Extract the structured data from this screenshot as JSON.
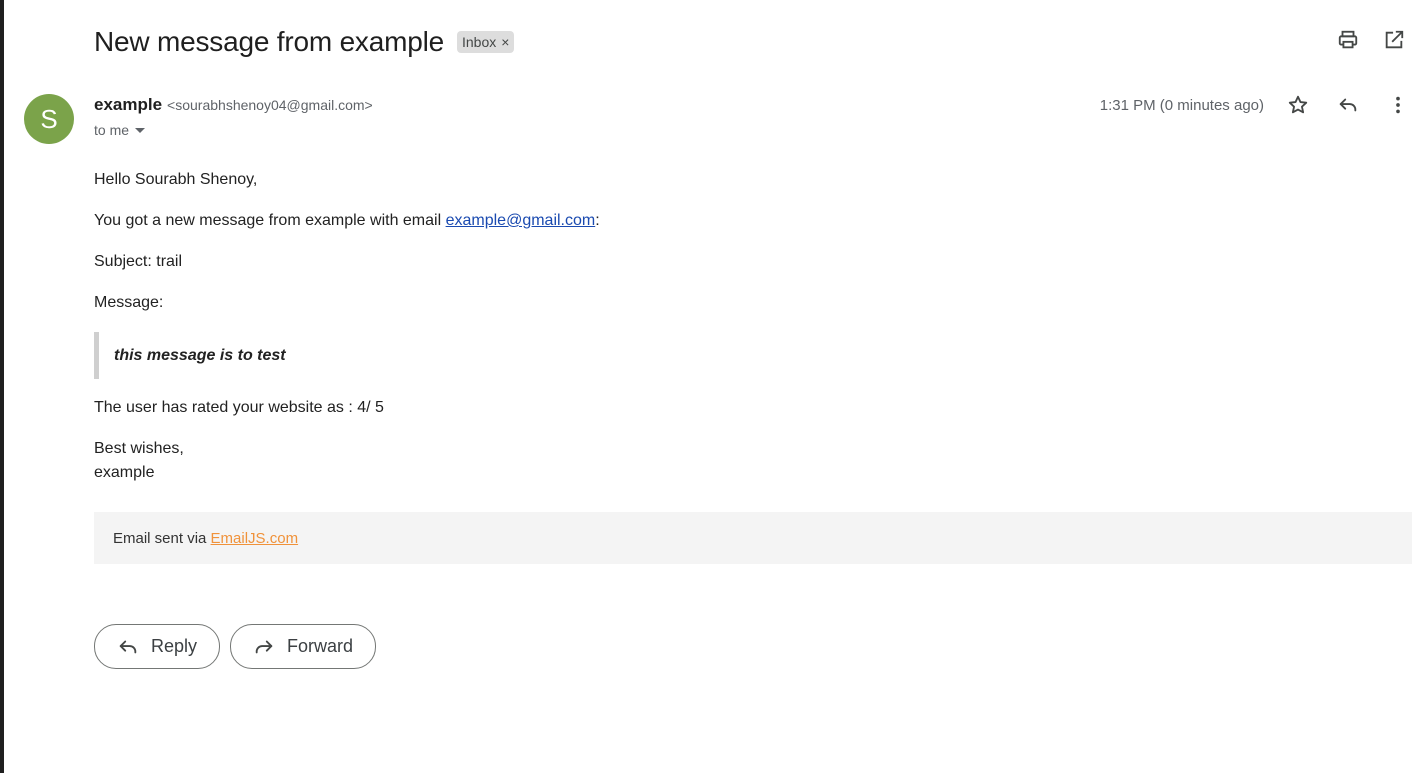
{
  "subject": "New message from example",
  "label_chip": {
    "text": "Inbox",
    "remove": "×"
  },
  "top_actions": {
    "print_icon": "printer-icon",
    "popout_icon": "open-in-new-window-icon"
  },
  "sender": {
    "avatar_letter": "S",
    "avatar_color": "#7ba34a",
    "name": "example",
    "email": "<sourabhshenoy04@gmail.com>",
    "recipient": "to me"
  },
  "meta": {
    "timestamp": "1:31 PM (0 minutes ago)",
    "star_icon": "star-icon",
    "reply_icon": "reply-icon",
    "more_icon": "more-vert-icon"
  },
  "body": {
    "greeting": "Hello Sourabh Shenoy,",
    "intro_prefix": "You got a new message from example with email ",
    "intro_email": "example@gmail.com",
    "intro_suffix": ":",
    "subject_line": "Subject: trail",
    "message_label": "Message:",
    "quote": "this message is to test",
    "rating": "The user has rated your website as : 4/ 5",
    "signoff_1": "Best wishes,",
    "signoff_2": "example"
  },
  "footer": {
    "prefix": "Email sent via ",
    "link": "EmailJS.com",
    "link_color": "#f0923a"
  },
  "actions": {
    "reply": "Reply",
    "forward": "Forward"
  }
}
